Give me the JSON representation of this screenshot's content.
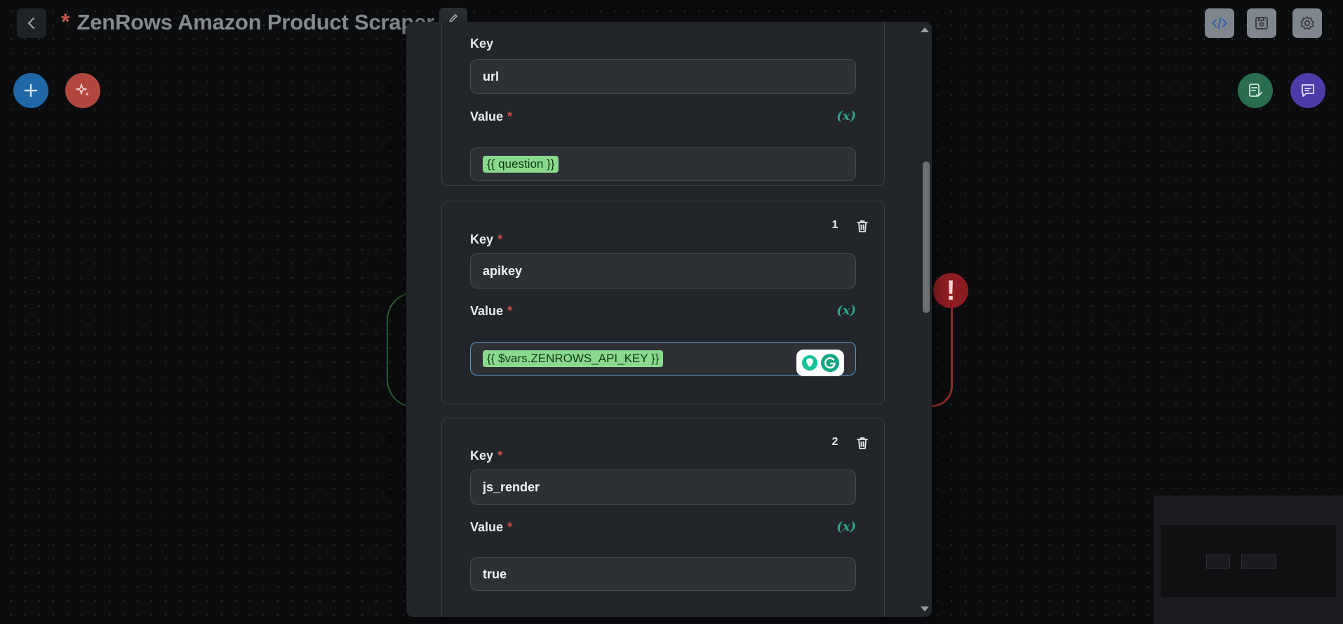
{
  "header": {
    "unsaved_marker": "*",
    "title": "ZenRows Amazon Product Scraper",
    "buttons": [
      "back-icon",
      "code-icon",
      "save-icon",
      "gear-icon"
    ]
  },
  "canvas_buttons": {
    "add": "plus-icon",
    "magic": "sparkle-icon",
    "validate": "checklist-icon",
    "chat": "chat-icon"
  },
  "warning_badge": "!",
  "dialog": {
    "items": [
      {
        "index": "",
        "key_label": "Key",
        "key_value": "url",
        "value_label": "Value",
        "value_chip": "{{ question }}"
      },
      {
        "index": "1",
        "key_label": "Key",
        "key_value": "apikey",
        "value_label": "Value",
        "value_chip": "{{ $vars.ZENROWS_API_KEY }}"
      },
      {
        "index": "2",
        "key_label": "Key",
        "key_value": "js_render",
        "value_label": "Value",
        "value_plain": "true"
      }
    ],
    "required_marker": "*",
    "variable_icon_text": "(x)"
  },
  "colors": {
    "accent_green": "#2fa58e",
    "chip_bg": "#8ad98e",
    "required": "#d04a44",
    "focus": "#5b9bd5"
  }
}
